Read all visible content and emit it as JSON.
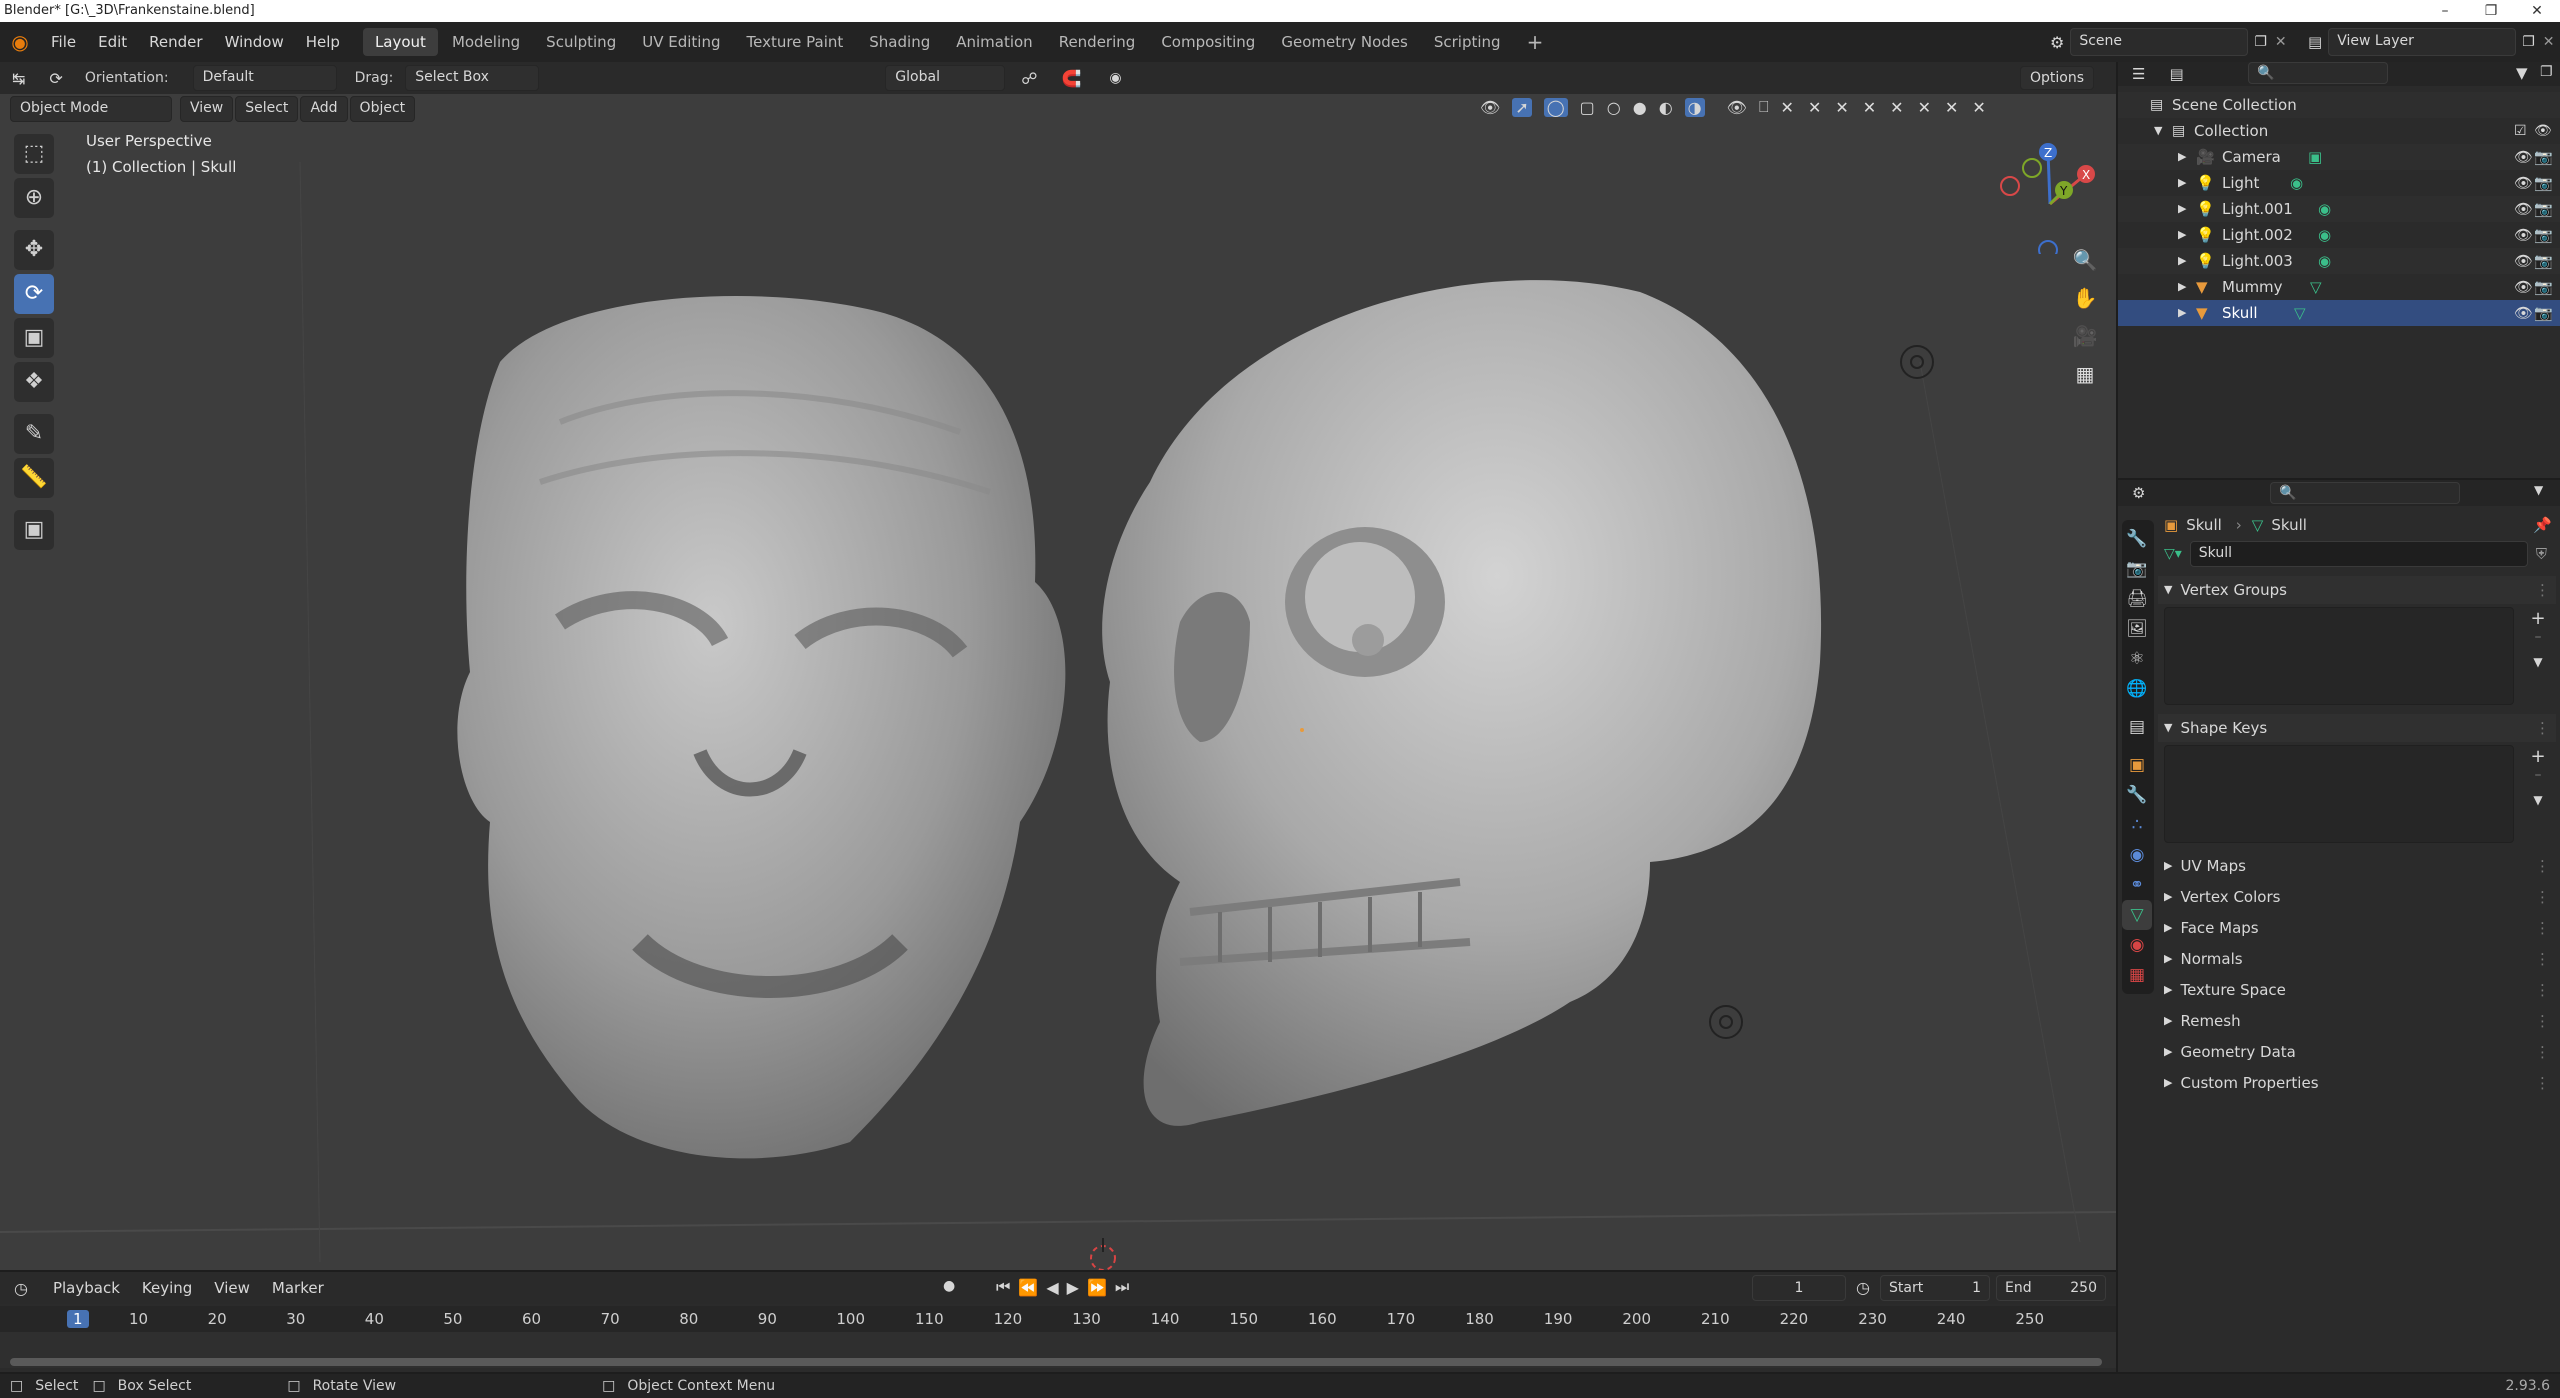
{
  "window": {
    "title": "Blender* [G:\\_3D\\Frankenstaine.blend]"
  },
  "menu": {
    "items": [
      "File",
      "Edit",
      "Render",
      "Window",
      "Help"
    ]
  },
  "workspaces": {
    "active": "Layout",
    "tabs": [
      "Layout",
      "Modeling",
      "Sculpting",
      "UV Editing",
      "Texture Paint",
      "Shading",
      "Animation",
      "Rendering",
      "Compositing",
      "Geometry Nodes",
      "Scripting"
    ],
    "add": "+"
  },
  "scene": {
    "label": "Scene",
    "view_layer": "View Layer"
  },
  "viewport_header": {
    "orientation_label": "Orientation:",
    "orientation_value": "Default",
    "drag_label": "Drag:",
    "drag_value": "Select Box",
    "transform_orientation": "Global",
    "options": "Options",
    "mode": "Object Mode",
    "menus": [
      "View",
      "Select",
      "Add",
      "Object"
    ]
  },
  "viewport": {
    "perspective": "User Perspective",
    "collection_info": "(1) Collection | Skull"
  },
  "gizmo": {
    "z": "Z",
    "y": "Y",
    "x": "X"
  },
  "outliner": {
    "root": "Scene Collection",
    "collection": "Collection",
    "items": [
      "Camera",
      "Light",
      "Light.001",
      "Light.002",
      "Light.003",
      "Mummy",
      "Skull"
    ]
  },
  "properties": {
    "breadcrumb_object": "Skull",
    "breadcrumb_data": "Skull",
    "data_name": "Skull",
    "panels": {
      "vertex_groups": "Vertex Groups",
      "shape_keys": "Shape Keys",
      "collapsed": [
        "UV Maps",
        "Vertex Colors",
        "Face Maps",
        "Normals",
        "Texture Space",
        "Remesh",
        "Geometry Data",
        "Custom Properties"
      ]
    }
  },
  "timeline": {
    "menus": [
      "Playback",
      "Keying",
      "View",
      "Marker"
    ],
    "current_frame": "1",
    "start_label": "Start",
    "start": "1",
    "end_label": "End",
    "end": "250",
    "ticks": [
      "1",
      "10",
      "20",
      "30",
      "40",
      "50",
      "60",
      "70",
      "80",
      "90",
      "100",
      "110",
      "120",
      "130",
      "140",
      "150",
      "160",
      "170",
      "180",
      "190",
      "200",
      "210",
      "220",
      "230",
      "240",
      "250"
    ]
  },
  "status_bar": {
    "select": "Select",
    "box_select": "Box Select",
    "rotate_view": "Rotate View",
    "context_menu": "Object Context Menu",
    "version": "2.93.6"
  }
}
